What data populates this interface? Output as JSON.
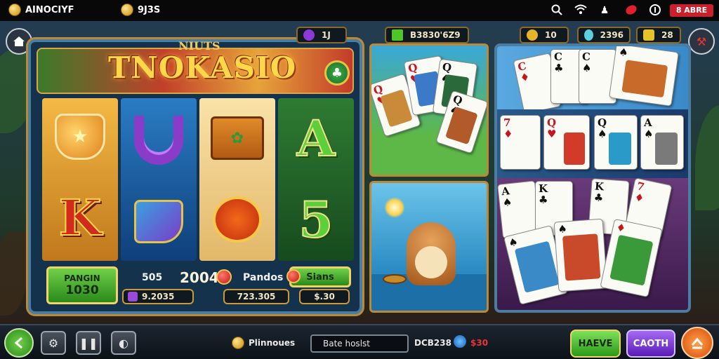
{
  "topbar": {
    "app_name": "AINOCIYF",
    "coins_value": "9J3S",
    "battery_text": "8 ABRE"
  },
  "slot": {
    "logo": "TNOKASIO",
    "crown_text": "NIUTS",
    "reel_letters": [
      "K",
      "A",
      "5"
    ],
    "spin_button": {
      "line1": "PANGIN",
      "line2": "1030"
    },
    "bet_label": "505",
    "bet_big": "2004",
    "paylines_label": "Pandos",
    "stats_button": "Sians",
    "field1": "9.2035",
    "field2": "723.305",
    "field3": "$.30"
  },
  "middle": {
    "top_counter": "B3830'6Z9",
    "level_counter": "1J"
  },
  "right": {
    "counter1": "10",
    "counter2": "2396",
    "counter3": "28",
    "cards_row1": [
      "C",
      "C",
      "C"
    ],
    "cards_row2": [
      "7",
      "Q",
      "Q",
      "A"
    ],
    "cards_row3": [
      "A",
      "K",
      "K",
      "7"
    ]
  },
  "bottombar": {
    "label1": "Plinnoues",
    "field_text": "Bate hoslst",
    "label2": "DCB238",
    "label3": "$30",
    "btn_green": "HAEVE",
    "btn_purple": "CAOTH"
  },
  "colors": {
    "accent_green": "#4fc52a",
    "accent_purple": "#8a3ad8",
    "accent_orange": "#ef6a16",
    "frame_gold": "#b98a3a"
  }
}
